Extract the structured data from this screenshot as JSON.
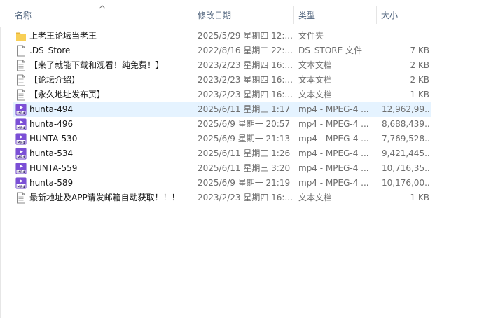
{
  "columns": {
    "name": "名称",
    "date": "修改日期",
    "type": "类型",
    "size": "大小"
  },
  "files": [
    {
      "name": "上老王论坛当老王",
      "date": "2025/5/29 星期四 12:...",
      "type": "文件夹",
      "size": "",
      "icon": "folder-icon",
      "selected": false
    },
    {
      "name": ".DS_Store",
      "date": "2022/8/16 星期二 22:...",
      "type": "DS_STORE 文件",
      "size": "7 KB",
      "icon": "file-icon",
      "selected": false
    },
    {
      "name": "【来了就能下载和观看！纯免费！】",
      "date": "2023/2/23 星期四 16:...",
      "type": "文本文档",
      "size": "2 KB",
      "icon": "text-document-icon",
      "selected": false
    },
    {
      "name": "【论坛介绍】",
      "date": "2023/2/23 星期四 16:...",
      "type": "文本文档",
      "size": "2 KB",
      "icon": "text-document-icon",
      "selected": false
    },
    {
      "name": "【永久地址发布页】",
      "date": "2023/2/23 星期四 16:...",
      "type": "文本文档",
      "size": "1 KB",
      "icon": "text-document-icon",
      "selected": false
    },
    {
      "name": "hunta-494",
      "date": "2025/6/11 星期三 1:17",
      "type": "mp4 - MPEG-4 ...",
      "size": "12,962,99...",
      "icon": "mp4-video-icon",
      "selected": true
    },
    {
      "name": "hunta-496",
      "date": "2025/6/9 星期一 20:57",
      "type": "mp4 - MPEG-4 ...",
      "size": "8,688,439...",
      "icon": "mp4-video-icon",
      "selected": false
    },
    {
      "name": "HUNTA-530",
      "date": "2025/6/9 星期一 21:13",
      "type": "mp4 - MPEG-4 ...",
      "size": "7,769,528...",
      "icon": "mp4-video-icon",
      "selected": false
    },
    {
      "name": "hunta-534",
      "date": "2025/6/11 星期三 1:26",
      "type": "mp4 - MPEG-4 ...",
      "size": "9,421,445...",
      "icon": "mp4-video-icon",
      "selected": false
    },
    {
      "name": "HUNTA-559",
      "date": "2025/6/11 星期三 3:20",
      "type": "mp4 - MPEG-4 ...",
      "size": "10,716,35...",
      "icon": "mp4-video-icon",
      "selected": false
    },
    {
      "name": "hunta-589",
      "date": "2025/6/9 星期一 21:19",
      "type": "mp4 - MPEG-4 ...",
      "size": "10,176,00...",
      "icon": "mp4-video-icon",
      "selected": false
    },
    {
      "name": "最新地址及APP请发邮箱自动获取！！！",
      "date": "2023/2/23 星期四 16:...",
      "type": "文本文档",
      "size": "1 KB",
      "icon": "text-document-icon",
      "selected": false
    }
  ],
  "colors": {
    "header_text": "#4c607a",
    "selected_row": "#e5f3ff",
    "folder": "#f6c444",
    "mp4_accent": "#6a3cc8",
    "secondary_text": "#6d6d6d"
  }
}
